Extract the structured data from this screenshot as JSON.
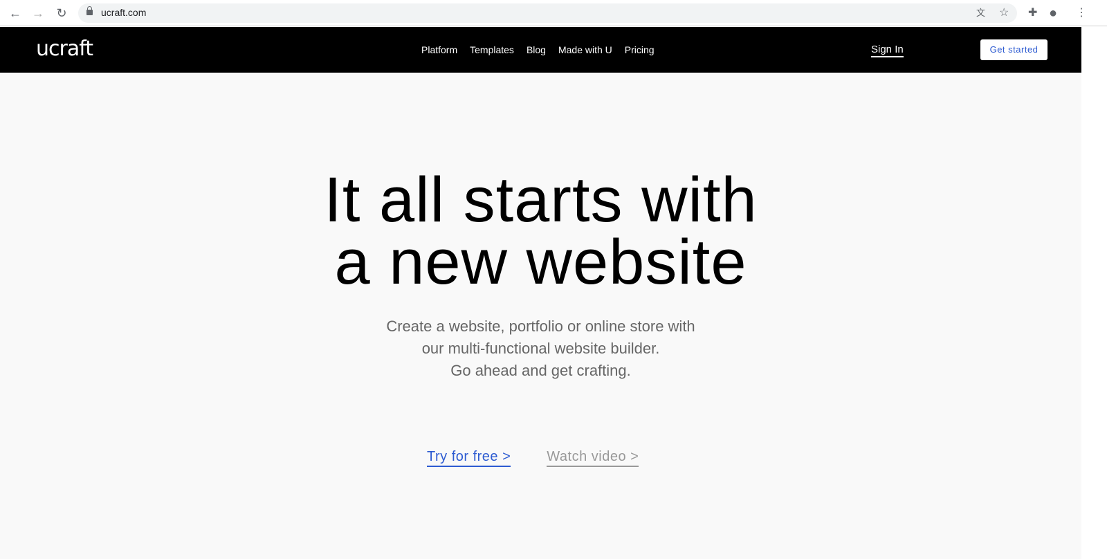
{
  "browser": {
    "url": "ucraft.com",
    "icons": [
      "back-icon",
      "forward-icon",
      "reload-icon",
      "lock-icon",
      "translate-icon",
      "star-icon",
      "extensions-icon",
      "profile-icon",
      "menu-icon"
    ]
  },
  "nav": {
    "logo": "ucraft",
    "items": [
      "Platform",
      "Templates",
      "Blog",
      "Made with U",
      "Pricing"
    ],
    "sign_in": "Sign In",
    "get_started": "Get started"
  },
  "hero": {
    "title_line1": "It all starts with",
    "title_line2": "a new website",
    "sub_line1": "Create a website, portfolio or online store with",
    "sub_line2": "our multi-functional website builder.",
    "sub_line3": "Go ahead and get crafting.",
    "try": "Try for free >",
    "watch": "Watch video >"
  },
  "colors": {
    "accent": "#2d5bd1",
    "nav_bg": "#000000",
    "page_bg": "#f9f9f9"
  }
}
